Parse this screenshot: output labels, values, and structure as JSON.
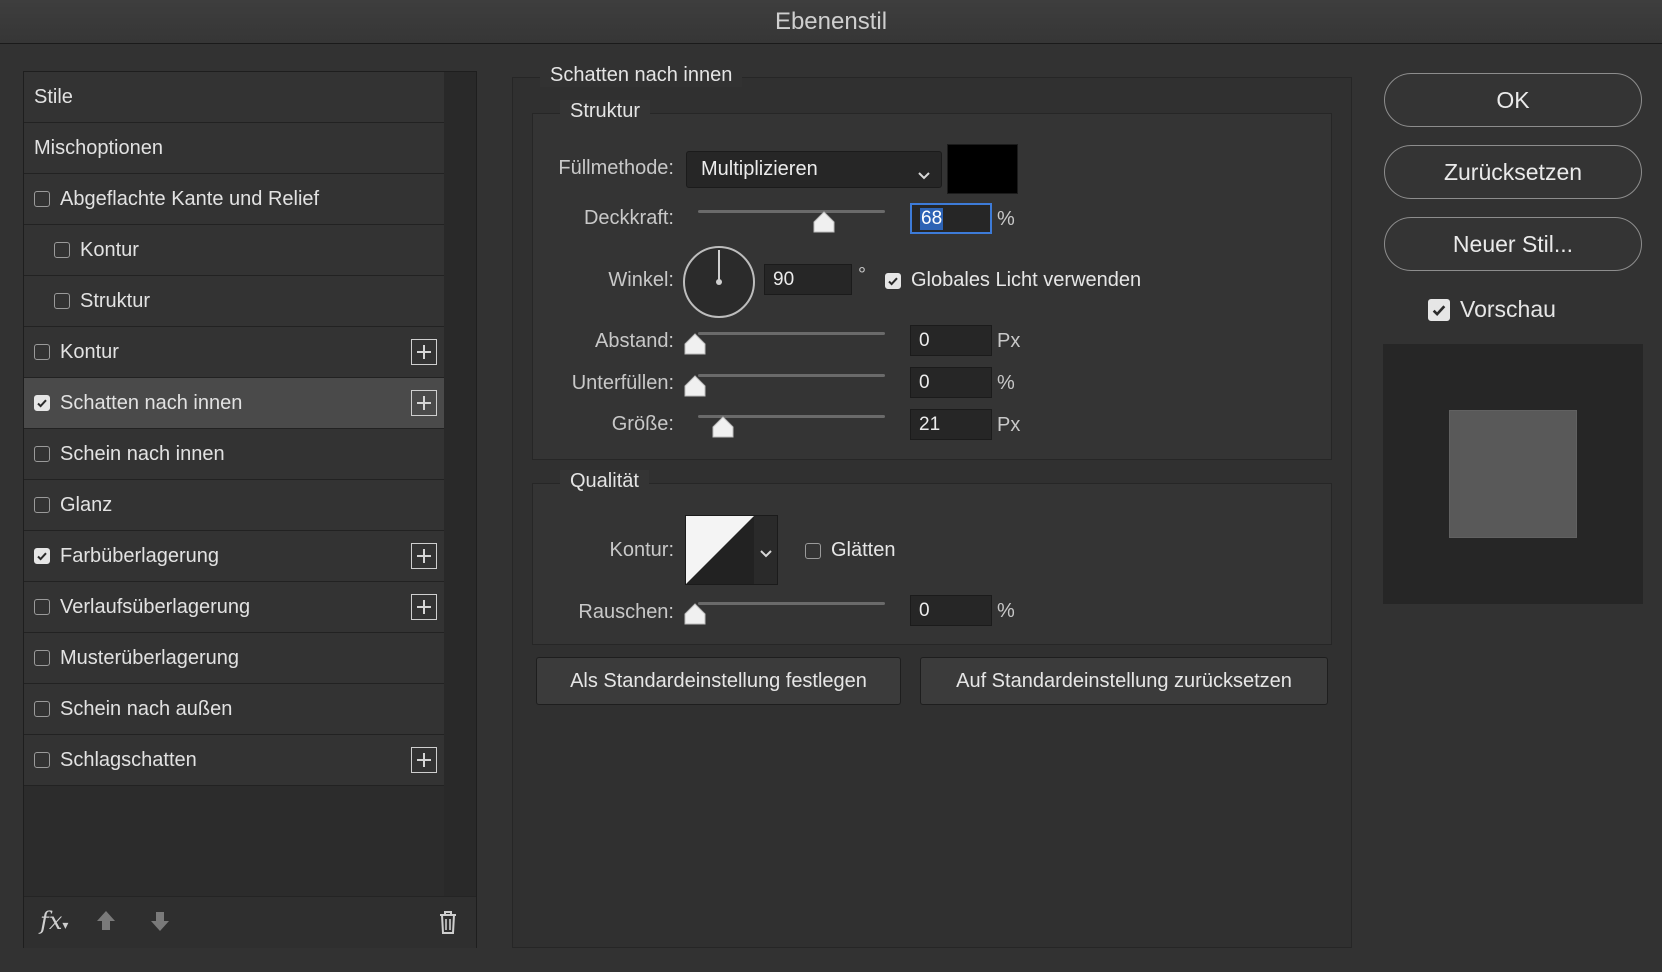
{
  "window": {
    "title": "Ebenenstil"
  },
  "style_list": {
    "items": [
      {
        "label": "Stile",
        "type": "header"
      },
      {
        "label": "Mischoptionen",
        "type": "header"
      },
      {
        "label": "Abgeflachte Kante und Relief",
        "checked": false
      },
      {
        "label": "Kontur",
        "checked": false,
        "indent": true
      },
      {
        "label": "Struktur",
        "checked": false,
        "indent": true
      },
      {
        "label": "Kontur",
        "checked": false,
        "plus": true
      },
      {
        "label": "Schatten nach innen",
        "checked": true,
        "plus": true,
        "selected": true
      },
      {
        "label": "Schein nach innen",
        "checked": false
      },
      {
        "label": "Glanz",
        "checked": false
      },
      {
        "label": "Farbüberlagerung",
        "checked": true,
        "plus": true
      },
      {
        "label": "Verlaufsüberlagerung",
        "checked": false,
        "plus": true
      },
      {
        "label": "Musterüberlagerung",
        "checked": false
      },
      {
        "label": "Schein nach außen",
        "checked": false
      },
      {
        "label": "Schlagschatten",
        "checked": false,
        "plus": true
      }
    ],
    "footer": {
      "fx_label": "fx",
      "icons": [
        "fx-icon",
        "arrow-up-icon",
        "arrow-down-icon",
        "trash-icon"
      ]
    }
  },
  "panel": {
    "title": "Schatten nach innen",
    "structure": {
      "title": "Struktur",
      "fill_method_label": "Füllmethode:",
      "fill_method_value": "Multiplizieren",
      "color": "#000000",
      "opacity_label": "Deckkraft:",
      "opacity_value": "68",
      "opacity_unit": "%",
      "opacity_fraction": 0.68,
      "angle_label": "Winkel:",
      "angle_value": "90",
      "angle_unit": "°",
      "global_light_label": "Globales Licht verwenden",
      "global_light_checked": true,
      "distance_label": "Abstand:",
      "distance_value": "0",
      "distance_unit": "Px",
      "choke_label": "Unterfüllen:",
      "choke_value": "0",
      "choke_unit": "%",
      "size_label": "Größe:",
      "size_value": "21",
      "size_unit": "Px"
    },
    "quality": {
      "title": "Qualität",
      "contour_label": "Kontur:",
      "smooth_label": "Glätten",
      "smooth_checked": false,
      "noise_label": "Rauschen:",
      "noise_value": "0",
      "noise_unit": "%"
    },
    "set_default_label": "Als Standardeinstellung festlegen",
    "reset_default_label": "Auf Standardeinstellung zurücksetzen"
  },
  "actions": {
    "ok_label": "OK",
    "reset_label": "Zurücksetzen",
    "new_style_label": "Neuer Stil...",
    "preview_label": "Vorschau",
    "preview_checked": true
  },
  "colors": {
    "accent": "#3d7bd8",
    "background": "#323232"
  }
}
